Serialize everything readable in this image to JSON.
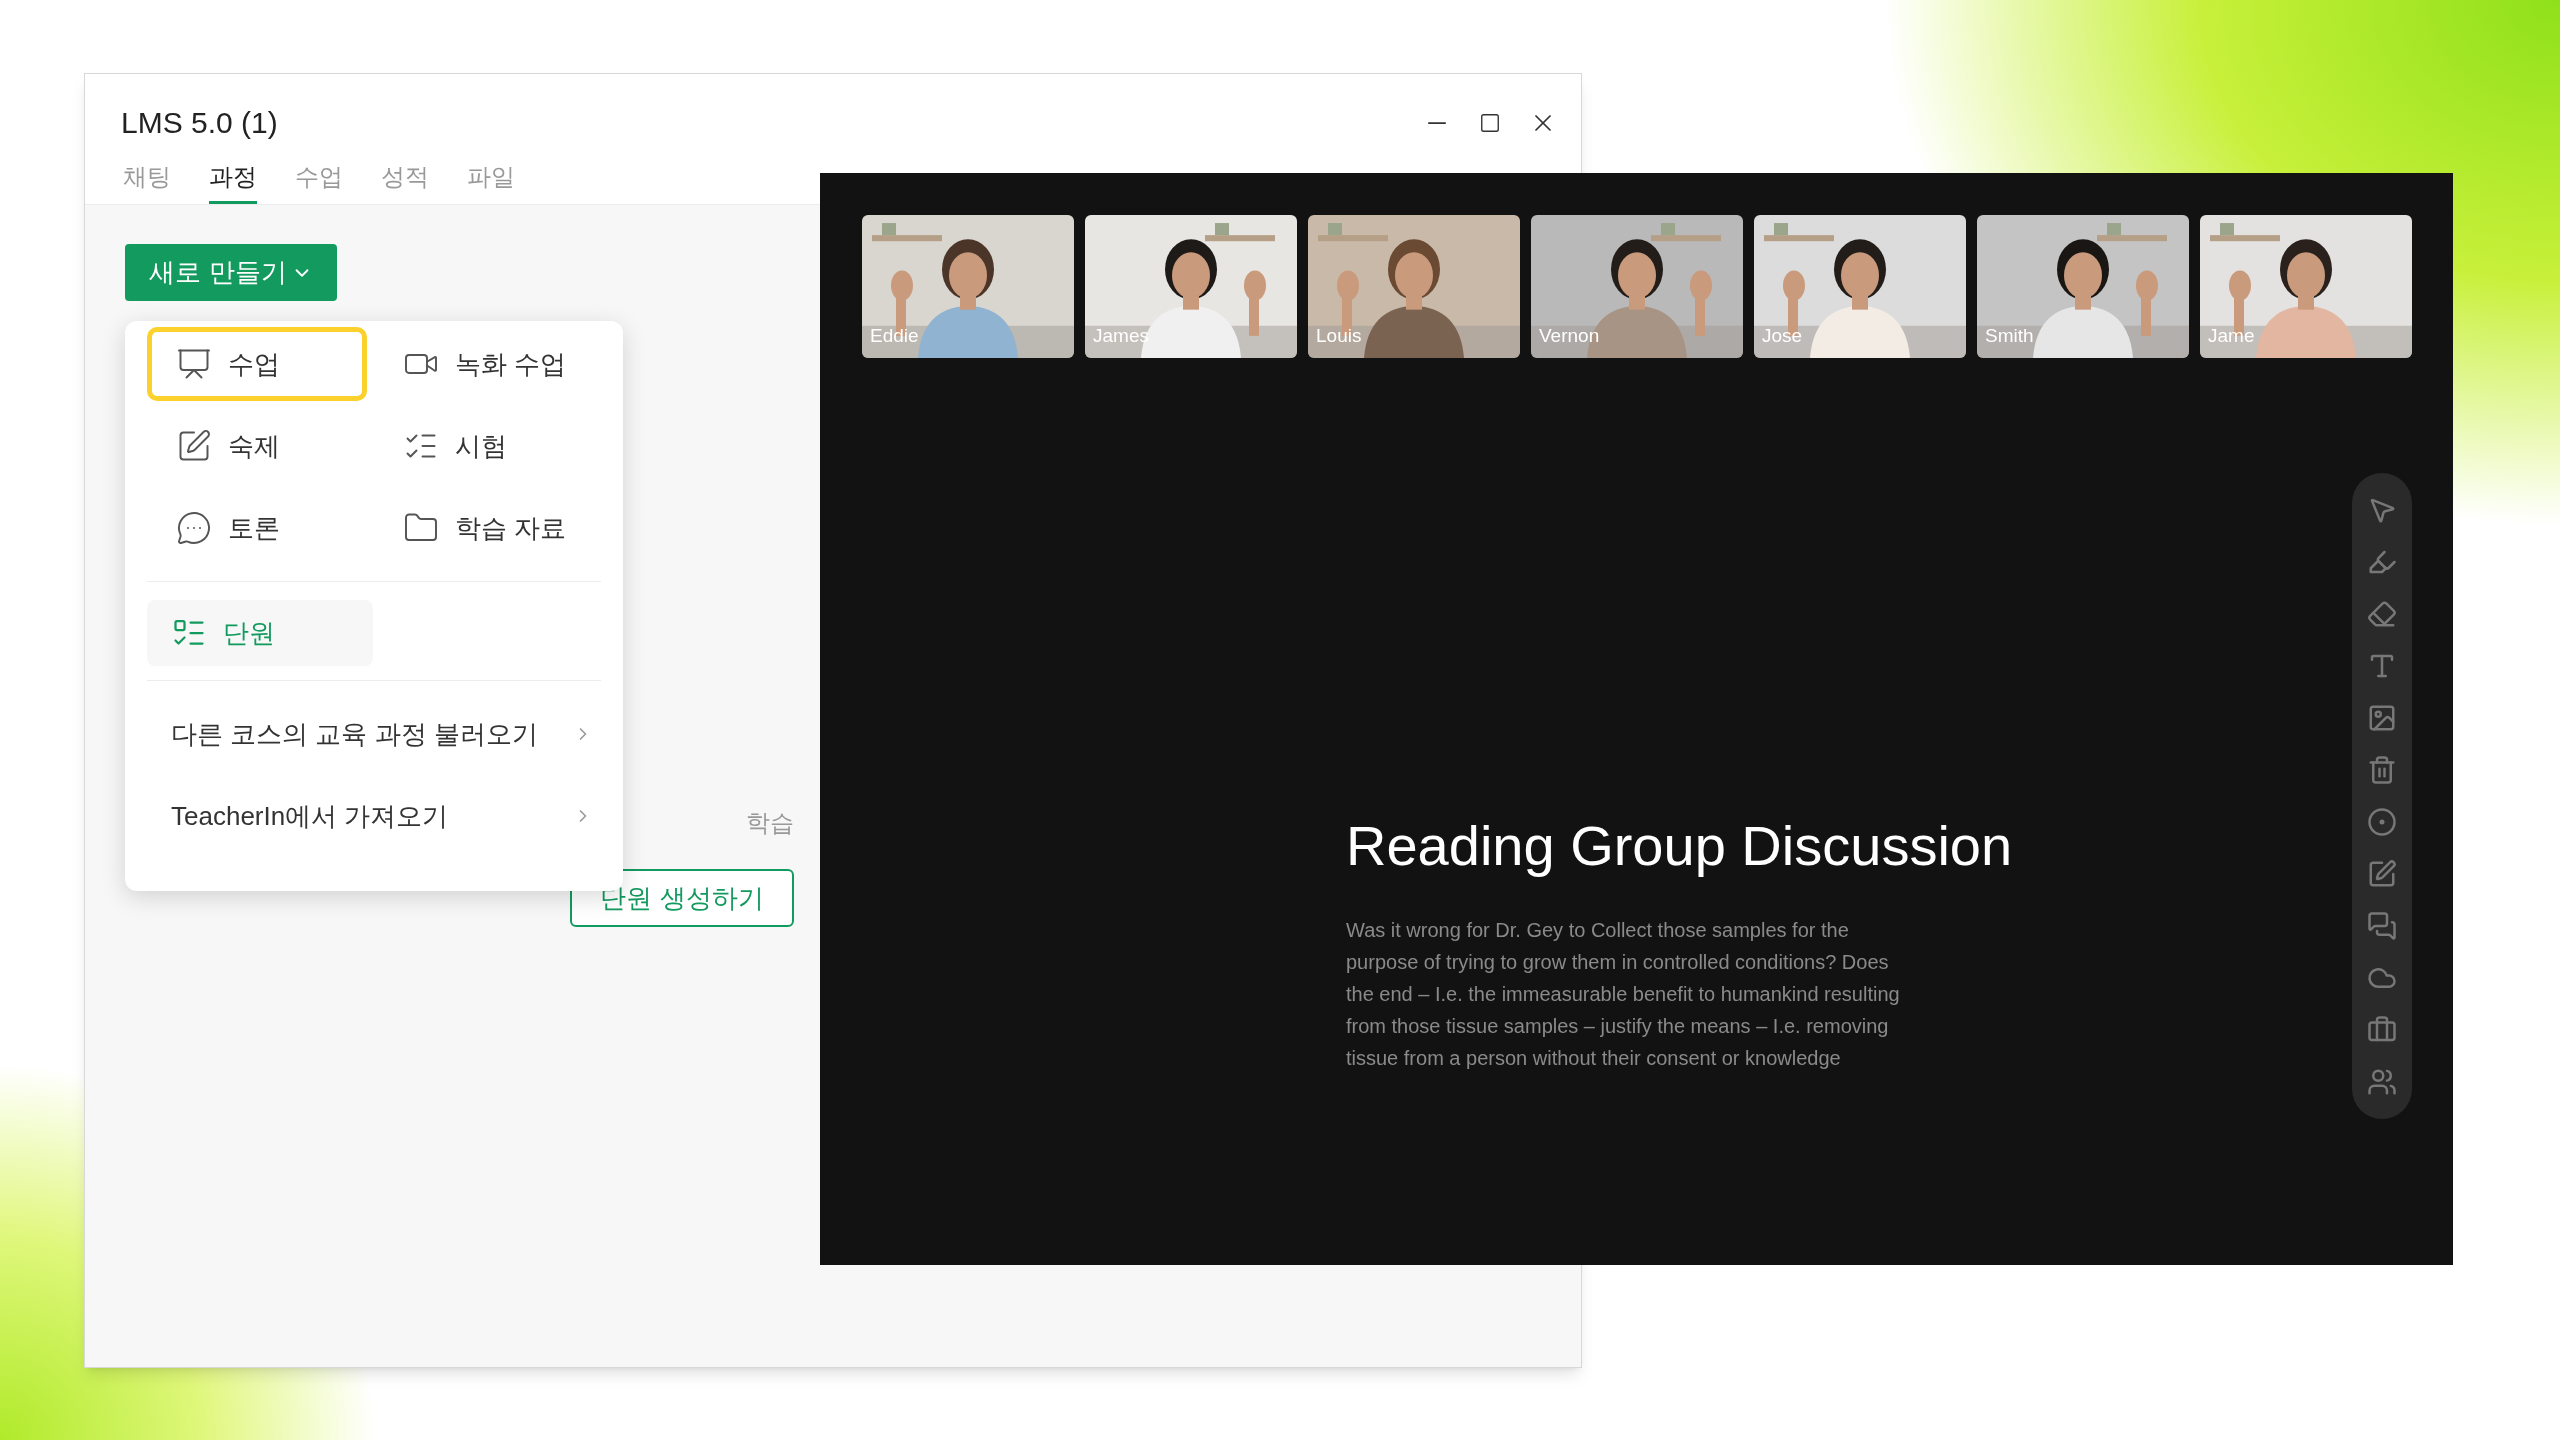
{
  "window": {
    "title": "LMS 5.0 (1)",
    "tabs": [
      {
        "label": "채팅",
        "selected": false
      },
      {
        "label": "과정",
        "selected": true
      },
      {
        "label": "수업",
        "selected": false
      },
      {
        "label": "성적",
        "selected": false
      },
      {
        "label": "파일",
        "selected": false
      }
    ],
    "new_button": {
      "label": "새로 만들기"
    },
    "menu": {
      "grid": [
        {
          "label": "수업",
          "highlighted": true
        },
        {
          "label": "녹화 수업",
          "highlighted": false
        },
        {
          "label": "숙제",
          "highlighted": false
        },
        {
          "label": "시험",
          "highlighted": false
        },
        {
          "label": "토론",
          "highlighted": false
        },
        {
          "label": "학습 자료",
          "highlighted": false
        }
      ],
      "unit": {
        "label": "단원",
        "selected": true
      },
      "links": [
        "다른 코스의 교육 과정 불러오기",
        "TeacherIn에서 가져오기"
      ]
    },
    "empty_state": {
      "text": "학습",
      "button": "단원 생성하기"
    }
  },
  "presentation": {
    "participants": [
      "Eddie",
      "James",
      "Louis",
      "Vernon",
      "Jose",
      "Smith",
      "Jame"
    ],
    "slide": {
      "title": "Reading Group Discussion",
      "body": "Was it wrong for Dr. Gey to Collect those samples for the purpose of trying to grow them in controlled conditions? Does the end – I.e. the immeasurable benefit to humankind resulting from those tissue samples – justify the means – I.e. removing tissue from a person without their consent or knowledge"
    }
  }
}
